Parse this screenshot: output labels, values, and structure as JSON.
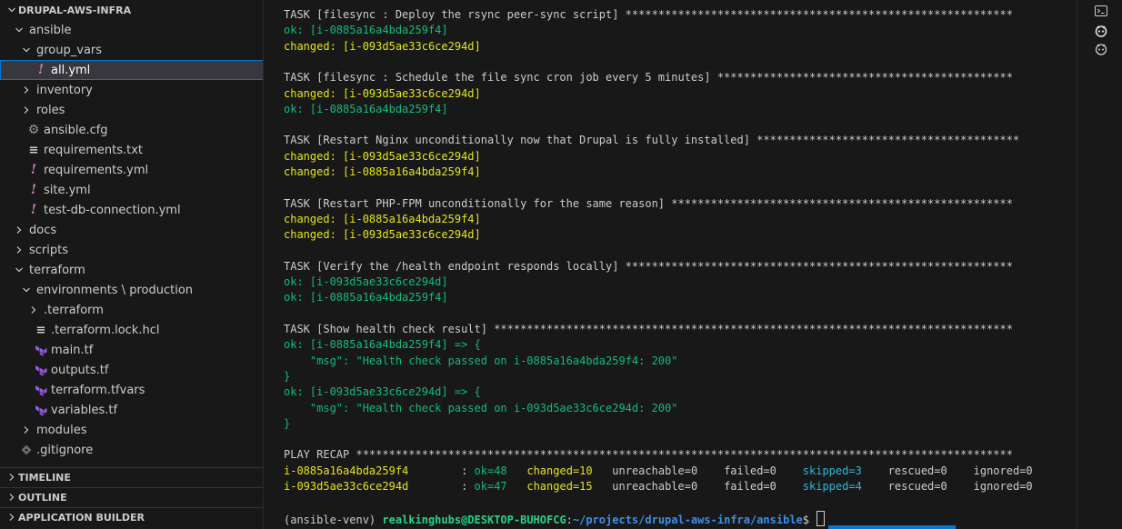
{
  "explorer": {
    "root_label": "DRUPAL-AWS-INFRA",
    "items": [
      {
        "label": "ansible",
        "depth": 1,
        "kind": "folder-open"
      },
      {
        "label": "group_vars",
        "depth": 2,
        "kind": "folder-open"
      },
      {
        "label": "all.yml",
        "depth": 3,
        "kind": "yaml",
        "selected": true
      },
      {
        "label": "inventory",
        "depth": 2,
        "kind": "folder"
      },
      {
        "label": "roles",
        "depth": 2,
        "kind": "folder"
      },
      {
        "label": "ansible.cfg",
        "depth": 2,
        "kind": "gear"
      },
      {
        "label": "requirements.txt",
        "depth": 2,
        "kind": "text"
      },
      {
        "label": "requirements.yml",
        "depth": 2,
        "kind": "yaml"
      },
      {
        "label": "site.yml",
        "depth": 2,
        "kind": "yaml"
      },
      {
        "label": "test-db-connection.yml",
        "depth": 2,
        "kind": "yaml"
      },
      {
        "label": "docs",
        "depth": 1,
        "kind": "folder"
      },
      {
        "label": "scripts",
        "depth": 1,
        "kind": "folder"
      },
      {
        "label": "terraform",
        "depth": 1,
        "kind": "folder-open"
      },
      {
        "label": "environments \\ production",
        "depth": 2,
        "kind": "folder-open"
      },
      {
        "label": ".terraform",
        "depth": 3,
        "kind": "folder"
      },
      {
        "label": ".terraform.lock.hcl",
        "depth": 3,
        "kind": "text"
      },
      {
        "label": "main.tf",
        "depth": 3,
        "kind": "terraform"
      },
      {
        "label": "outputs.tf",
        "depth": 3,
        "kind": "terraform"
      },
      {
        "label": "terraform.tfvars",
        "depth": 3,
        "kind": "terraform"
      },
      {
        "label": "variables.tf",
        "depth": 3,
        "kind": "terraform"
      },
      {
        "label": "modules",
        "depth": 2,
        "kind": "folder"
      },
      {
        "label": ".gitignore",
        "depth": 1,
        "kind": "git"
      }
    ],
    "sections": [
      "TIMELINE",
      "OUTLINE",
      "APPLICATION BUILDER"
    ]
  },
  "terminal": {
    "lines": [
      [
        {
          "t": "TASK [filesync : Deploy the rsync peer-sync script] ***********************************************************",
          "c": "text"
        }
      ],
      [
        {
          "t": "ok: [i-0885a16a4bda259f4]",
          "c": "ok"
        }
      ],
      [
        {
          "t": "changed: [i-093d5ae33c6ce294d]",
          "c": "changed"
        }
      ],
      [],
      [
        {
          "t": "TASK [filesync : Schedule the file sync cron job every 5 minutes] *********************************************",
          "c": "text"
        }
      ],
      [
        {
          "t": "changed: [i-093d5ae33c6ce294d]",
          "c": "changed"
        }
      ],
      [
        {
          "t": "ok: [i-0885a16a4bda259f4]",
          "c": "ok"
        }
      ],
      [],
      [
        {
          "t": "TASK [Restart Nginx unconditionally now that Drupal is fully installed] ****************************************",
          "c": "text"
        }
      ],
      [
        {
          "t": "changed: [i-093d5ae33c6ce294d]",
          "c": "changed"
        }
      ],
      [
        {
          "t": "changed: [i-0885a16a4bda259f4]",
          "c": "changed"
        }
      ],
      [],
      [
        {
          "t": "TASK [Restart PHP-FPM unconditionally for the same reason] ****************************************************",
          "c": "text"
        }
      ],
      [
        {
          "t": "changed: [i-0885a16a4bda259f4]",
          "c": "changed"
        }
      ],
      [
        {
          "t": "changed: [i-093d5ae33c6ce294d]",
          "c": "changed"
        }
      ],
      [],
      [
        {
          "t": "TASK [Verify the /health endpoint responds locally] ***********************************************************",
          "c": "text"
        }
      ],
      [
        {
          "t": "ok: [i-093d5ae33c6ce294d]",
          "c": "ok"
        }
      ],
      [
        {
          "t": "ok: [i-0885a16a4bda259f4]",
          "c": "ok"
        }
      ],
      [],
      [
        {
          "t": "TASK [Show health check result] *******************************************************************************",
          "c": "text"
        }
      ],
      [
        {
          "t": "ok: [i-0885a16a4bda259f4] => {",
          "c": "ok"
        }
      ],
      [
        {
          "t": "    \"msg\": \"Health check passed on i-0885a16a4bda259f4: 200\"",
          "c": "ok"
        }
      ],
      [
        {
          "t": "}",
          "c": "ok"
        }
      ],
      [
        {
          "t": "ok: [i-093d5ae33c6ce294d] => {",
          "c": "ok"
        }
      ],
      [
        {
          "t": "    \"msg\": \"Health check passed on i-093d5ae33c6ce294d: 200\"",
          "c": "ok"
        }
      ],
      [
        {
          "t": "}",
          "c": "ok"
        }
      ],
      [],
      [
        {
          "t": "PLAY RECAP ****************************************************************************************************",
          "c": "text"
        }
      ],
      [
        {
          "t": "i-0885a16a4bda259f4",
          "c": "changed"
        },
        {
          "t": "        : ",
          "c": "text"
        },
        {
          "t": "ok=48 ",
          "c": "ok"
        },
        {
          "t": "  ",
          "c": "text"
        },
        {
          "t": "changed=10",
          "c": "changed"
        },
        {
          "t": "   unreachable=0    failed=0    ",
          "c": "text"
        },
        {
          "t": "skipped=3",
          "c": "cyan"
        },
        {
          "t": "    rescued=0    ignored=0",
          "c": "text"
        }
      ],
      [
        {
          "t": "i-093d5ae33c6ce294d",
          "c": "changed"
        },
        {
          "t": "        : ",
          "c": "text"
        },
        {
          "t": "ok=47 ",
          "c": "ok"
        },
        {
          "t": "  ",
          "c": "text"
        },
        {
          "t": "changed=15",
          "c": "changed"
        },
        {
          "t": "   unreachable=0    failed=0    ",
          "c": "text"
        },
        {
          "t": "skipped=4",
          "c": "cyan"
        },
        {
          "t": "    rescued=0    ignored=0",
          "c": "text"
        }
      ],
      [],
      [
        {
          "t": "(ansible-venv) ",
          "c": "text"
        },
        {
          "t": "realkinghubs@DESKTOP-BUHOFCG",
          "c": "user"
        },
        {
          "t": ":",
          "c": "text"
        },
        {
          "t": "~/projects/drupal-aws-infra/ansible",
          "c": "path"
        },
        {
          "t": "$ ",
          "c": "text"
        }
      ]
    ]
  },
  "right_panel": {
    "items": [
      "terminal-icon",
      "copilot-icon",
      "copilot-chat-icon"
    ]
  },
  "colors": {
    "background": "#181818",
    "ok": "#0dbc79",
    "changed": "#e5e510",
    "cyan": "#29b8db",
    "accent": "#0078d4",
    "yaml": "#c586c0",
    "terraform": "#8e5bd6"
  }
}
